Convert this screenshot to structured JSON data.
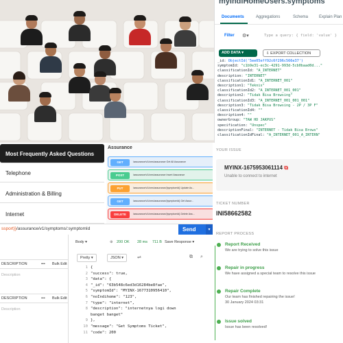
{
  "mongo": {
    "title": "myIndiHomeUsers.symptoms",
    "tabs": [
      "Documents",
      "Aggregations",
      "Schema",
      "Explain Plan"
    ],
    "filter_label": "Filter",
    "filter_placeholder": "Type a query: { field: 'value' }",
    "add_data": "ADD DATA",
    "export": "EXPORT COLLECTION",
    "doc_lines": [
      {
        "k": "_id:",
        "v": "ObjectId('5ee05eff92c6f296c566e37')"
      },
      {
        "k": "symptomId:",
        "v": "\"c1b9e31-ec3c-4291-993d-5cb0baad0d...\""
      },
      {
        "k": "classificationId:",
        "v": "\"A_INTERNET\""
      },
      {
        "k": "description:",
        "v": "\"INTERNET\""
      },
      {
        "k": "classificationId1:",
        "v": "\"A_INTERNET_001\""
      },
      {
        "k": "description1:",
        "v": "\"Teknis\""
      },
      {
        "k": "classificationId2:",
        "v": "\"A_INTERNET_001_001\""
      },
      {
        "k": "description2:",
        "v": "\"Tidak Bisa Browsing\""
      },
      {
        "k": "classificationId3:",
        "v": "\"A_INTERNET_001_001_001\""
      },
      {
        "k": "description3:",
        "v": "\"Tidak Bisa Browsing - 2P / 3P F\""
      },
      {
        "k": "classificationId4:",
        "v": "\"\""
      },
      {
        "k": "description4:",
        "v": "\"\""
      },
      {
        "k": "ownerGroup:",
        "v": "\"TAW HD JAKPUS\""
      },
      {
        "k": "specification:",
        "v": "\"Unspec\""
      },
      {
        "k": "descriptionFinal:",
        "v": "\"INTERNET - Tidak Bisa Brows\""
      },
      {
        "k": "classificationIdFinal:",
        "v": "\"A_INTERNET_001_A_INTERN\""
      }
    ]
  },
  "sidebar": {
    "items": [
      "Most Frequently Asked Questions",
      "Telephone",
      "Administration & Billing",
      "Internet"
    ]
  },
  "swagger": {
    "title": "Assurance",
    "ops": [
      {
        "method": "GET",
        "path": "/assurance/v1/cms/assurance  Get All Assurance"
      },
      {
        "method": "POST",
        "path": "/assurance/v1/cms/assurance  Insert Assurance"
      },
      {
        "method": "PUT",
        "path": "/assurance/v1/cms/assurance/{symptomId}  Update As..."
      },
      {
        "method": "GET",
        "path": "/assurance/v1/cms/assurance/{symptomId}  Get Assur..."
      },
      {
        "method": "DELETE",
        "path": "/assurance/v1/cms/assurance/{symptomId}  Delete Ass..."
      }
    ],
    "colors": {
      "GET": "#61affe",
      "POST": "#49cc90",
      "PUT": "#fca130",
      "DELETE": "#f93e3e"
    }
  },
  "ticket": {
    "your_issue": "YOUR ISSUE",
    "issue_id": "MYINX-1675953061114",
    "issue_desc": "Unable to connect to internet",
    "ticket_number_label": "TICKET NUMBER",
    "ticket_number": "INI58662582",
    "report_progress": "REPORT PROCESS",
    "steps": [
      {
        "title": "Report Received",
        "desc": "We are trying to solve this issue",
        "desc2": ""
      },
      {
        "title": "Repair in progress",
        "desc": "We have assigned a special team to resolve this issue",
        "desc2": ""
      },
      {
        "title": "Repair Complete",
        "desc": "Our team has finished repairing the issue!",
        "desc2": "30 January 2024 03:31"
      },
      {
        "title": "Issue solved",
        "desc": "Issue has been resolved!",
        "desc2": ""
      }
    ]
  },
  "urlbar": {
    "var": "ssport}}",
    "path": "/assurance/v1/symptoms/:symptomId",
    "send": "Send"
  },
  "params": {
    "col1": "DESCRIPTION",
    "col2": "Bulk Edit",
    "placeholder": "Description",
    "dots": "•••"
  },
  "response": {
    "body_tab": "Body",
    "status": "200 OK",
    "time": "28 ms",
    "size": "711 B",
    "save": "Save Response",
    "pretty": "Pretty",
    "json": "JSON",
    "lines": [
      "{",
      "  \"success\": true,",
      "  \"data\": {",
      "    \"_id\": \"63b548c6ed3d16284be8fae\",",
      "    \"symptomId\": \"MYINX-1677310956410\",",
      "    \"noIndihome\": \"123\",",
      "    \"type\": \"internet\",",
      "    \"description\": \"internetnya logi down",
      "        banget banget\"",
      "  },",
      "  \"message\": \"Get Symptoms Ticket\",",
      "  \"code\": 200"
    ],
    "line_numbers": [
      "1",
      "2",
      "3",
      "4",
      "5",
      "6",
      "7",
      "8",
      "",
      "9",
      "10",
      "11"
    ]
  }
}
